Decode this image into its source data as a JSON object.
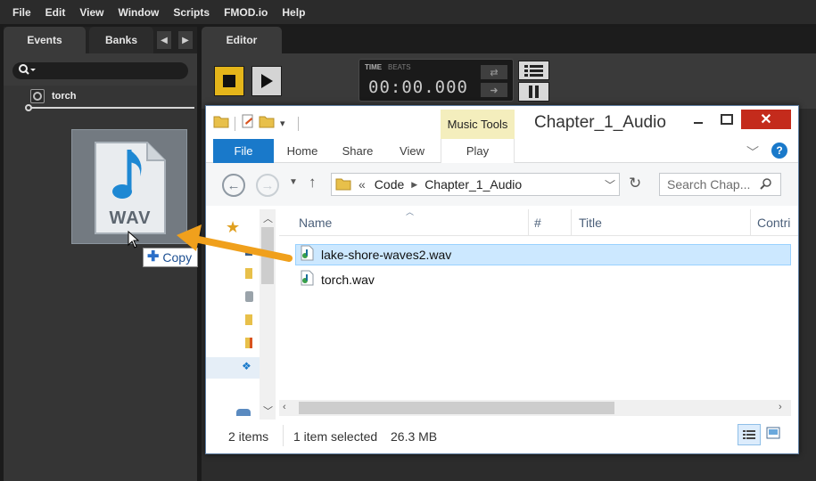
{
  "menubar": [
    "File",
    "Edit",
    "View",
    "Window",
    "Scripts",
    "FMOD.io",
    "Help"
  ],
  "left_panel": {
    "tabs": {
      "events": "Events",
      "banks": "Banks"
    },
    "search_icon": "magnifier-dropdown-icon",
    "event_name": "torch"
  },
  "drag": {
    "icon_text": "WAV",
    "tooltip_label": "Copy"
  },
  "editor": {
    "tab": "Editor",
    "time_label": "TIME",
    "beats_label": "BEATS",
    "time_value": "00:00.000"
  },
  "explorer": {
    "title": "Chapter_1_Audio",
    "contextual_tab": "Music Tools",
    "ribbon_tabs": [
      "File",
      "Home",
      "Share",
      "View",
      "Play"
    ],
    "breadcrumb": {
      "prefix": "«",
      "parts": [
        "Code",
        "Chapter_1_Audio"
      ]
    },
    "search_placeholder": "Search Chap...",
    "columns": [
      "Name",
      "#",
      "Title",
      "Contri"
    ],
    "files": [
      {
        "name": "lake-shore-waves2.wav",
        "selected": true
      },
      {
        "name": "torch.wav",
        "selected": false
      }
    ],
    "status": {
      "items": "2 items",
      "selection": "1 item selected",
      "size": "26.3 MB"
    }
  },
  "colors": {
    "fmod_accent": "#e4b51a",
    "drag_arrow": "#f0a01c",
    "selection": "#cce8ff",
    "ribbon_file": "#1979ca",
    "close_button": "#c42b1c"
  }
}
